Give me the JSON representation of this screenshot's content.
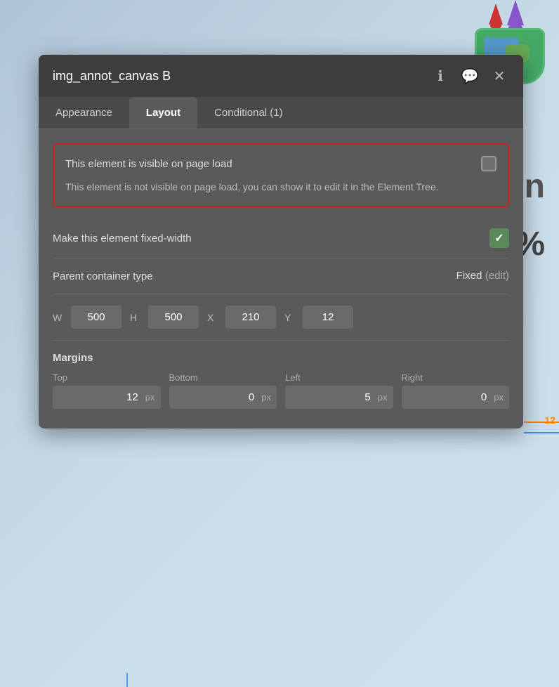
{
  "background": {
    "text_on": "on",
    "text_percent": "%",
    "right_number": "12"
  },
  "panel": {
    "title": "img_annot_canvas B",
    "icons": {
      "info": "ℹ",
      "comment": "💬",
      "close": "✕"
    },
    "tabs": [
      {
        "id": "appearance",
        "label": "Appearance",
        "active": false
      },
      {
        "id": "layout",
        "label": "Layout",
        "active": true
      },
      {
        "id": "conditional",
        "label": "Conditional (1)",
        "active": false
      }
    ],
    "layout": {
      "visibility": {
        "label": "This element is visible on page load",
        "note": "This element is not visible on page load, you can show it to edit it in the Element Tree.",
        "checked": false
      },
      "fixed_width": {
        "label": "Make this element fixed-width",
        "checked": true
      },
      "parent_container": {
        "label": "Parent container type",
        "value": "Fixed",
        "edit_label": "(edit)"
      },
      "dimensions": {
        "w_label": "W",
        "w_value": "500",
        "h_label": "H",
        "h_value": "500",
        "x_label": "X",
        "x_value": "210",
        "y_label": "Y",
        "y_value": "12"
      },
      "margins": {
        "title": "Margins",
        "top_label": "Top",
        "top_value": "12",
        "top_unit": "px",
        "bottom_label": "Bottom",
        "bottom_value": "0",
        "bottom_unit": "px",
        "left_label": "Left",
        "left_value": "5",
        "left_unit": "px",
        "right_label": "Right",
        "right_value": "0",
        "right_unit": "px"
      }
    }
  }
}
